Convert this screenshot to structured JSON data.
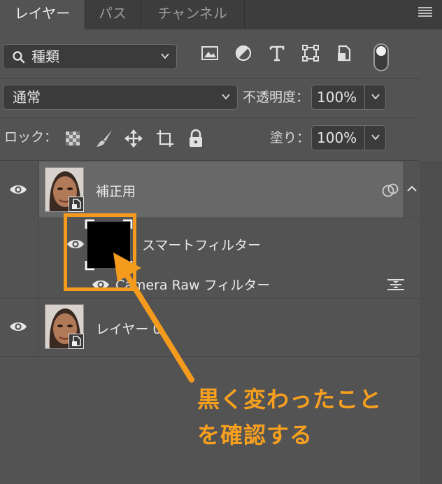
{
  "tabs": [
    {
      "label": "レイヤー",
      "active": true
    },
    {
      "label": "パス",
      "active": false
    },
    {
      "label": "チャンネル",
      "active": false
    }
  ],
  "filter": {
    "label": "種類"
  },
  "blend": {
    "mode": "通常",
    "opacity_label": "不透明度：",
    "opacity_value": "100%"
  },
  "lock": {
    "label": "ロック：",
    "fill_label": "塗り：",
    "fill_value": "100%"
  },
  "layers": [
    {
      "name": "補正用",
      "type": "smart-object",
      "expanded": true,
      "selected": true
    },
    {
      "name": "レイヤー 0",
      "type": "smart-object",
      "selected": false
    }
  ],
  "smart_filters": {
    "label": "スマートフィルター",
    "items": [
      {
        "name": "Camera Raw フィルター"
      }
    ]
  },
  "annotation": {
    "line1": "黒く変わったこと",
    "line2": "を確認する"
  },
  "colors": {
    "panel": "#535353",
    "tabbar": "#3d3d3d",
    "selected_layer": "#686868",
    "annotation": "#f49b1e"
  }
}
